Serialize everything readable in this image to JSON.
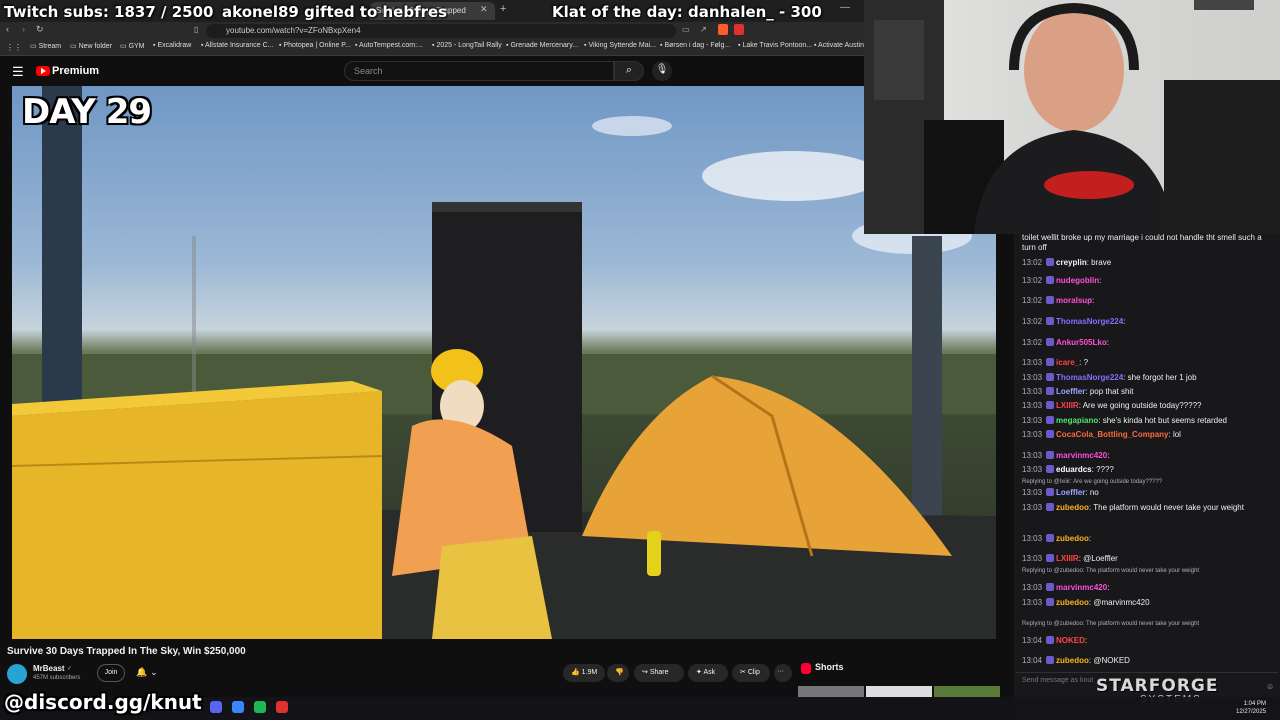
{
  "overlay": {
    "subs_text": "Twitch subs: 1837 / 2500",
    "gift_text": "akonel89 gifted to hebfres",
    "klat_text": "Klat of the day: danhalen_ - 300",
    "discord_text": "@discord.gg/knut"
  },
  "browser": {
    "active_tab": "Survive 30 Days Trapped",
    "url": "youtube.com/watch?v=ZFoNBxpXen4",
    "bookmarks": [
      "Stream",
      "New folder",
      "GYM",
      "Excalidraw",
      "Allstate Insurance C...",
      "Photopea | Online P...",
      "AutoTempest.com:...",
      "2025 - LongTail Rally",
      "Grenade Mercenary...",
      "Viking Syttende Mai...",
      "Børsen i dag - Følg...",
      "Lake Travis Pontoon...",
      "Activate Austin"
    ]
  },
  "youtube": {
    "brand": "Premium",
    "search_placeholder": "Search",
    "day_label": "DAY 29",
    "video_title": "Survive 30 Days Trapped In The Sky, Win $250,000",
    "channel_name": "MrBeast",
    "channel_subs": "457M subscribers",
    "join_label": "Join",
    "like_count": "1.9M",
    "share_label": "Share",
    "ask_label": "Ask",
    "clip_label": "Clip",
    "more_label": "···",
    "shorts_label": "Shorts"
  },
  "chat": {
    "colors": {
      "bg": "#18181b",
      "accent": "#9147ff"
    },
    "lines": [
      {
        "time": "",
        "user": "",
        "color": "#efeff1",
        "msg": "toilet wellit broke up my marriage i could not handle tht smell such a turn off"
      },
      {
        "time": "13:02",
        "user": "creyplin",
        "color": "#f1f1f1",
        "msg": "brave"
      },
      {
        "time": "13:02",
        "user": "nudegoblin",
        "color": "#ff4fd8",
        "msg": ""
      },
      {
        "time": "13:02",
        "user": "moralsup",
        "color": "#ff4fd8",
        "msg": ""
      },
      {
        "time": "13:02",
        "user": "ThomasNorge224",
        "color": "#8a6cff",
        "msg": ""
      },
      {
        "time": "13:02",
        "user": "Ankur505Lko",
        "color": "#ff4fd8",
        "msg": ""
      },
      {
        "time": "13:03",
        "user": "icare_",
        "color": "#ff4444",
        "msg": "?"
      },
      {
        "time": "13:03",
        "user": "ThomasNorge224",
        "color": "#8a6cff",
        "msg": "she forgot her 1 job"
      },
      {
        "time": "13:03",
        "user": "Loeffler",
        "color": "#9aa6ff",
        "msg": "pop that shit"
      },
      {
        "time": "13:03",
        "user": "LXIIIR",
        "color": "#ff4444",
        "msg": "Are we going outside today?????"
      },
      {
        "time": "13:03",
        "user": "megapiano",
        "color": "#4ee66b",
        "msg": "she's kinda hot but seems retarded"
      },
      {
        "time": "13:03",
        "user": "CocaCola_Bottling_Company",
        "color": "#ff6a3d",
        "msg": "lol"
      },
      {
        "time": "13:03",
        "user": "marvinmc420",
        "color": "#ff4fd8",
        "msg": ""
      },
      {
        "time": "13:03",
        "user": "eduardcs",
        "color": "#ffffff",
        "msg": "????"
      },
      {
        "time": "",
        "user": "",
        "color": "#adadb8",
        "msg": "Replying to @lxiiir: Are we going outside today?????"
      },
      {
        "time": "13:03",
        "user": "Loeffler",
        "color": "#9aa6ff",
        "msg": "no"
      },
      {
        "time": "13:03",
        "user": "zubedoo",
        "color": "#ffb31a",
        "msg": "The platform would never take your weight"
      },
      {
        "time": "13:03",
        "user": "zubedoo",
        "color": "#ffb31a",
        "msg": ""
      },
      {
        "time": "13:03",
        "user": "LXIIIR",
        "color": "#ff4444",
        "msg": "@Loeffler"
      },
      {
        "time": "",
        "user": "",
        "color": "#adadb8",
        "msg": "Replying to @zubedoo: The platform would never take your weight"
      },
      {
        "time": "13:03",
        "user": "marvinmc420",
        "color": "#ff4fd8",
        "msg": ""
      },
      {
        "time": "13:03",
        "user": "zubedoo",
        "color": "#ffb31a",
        "msg": "@marvinmc420"
      },
      {
        "time": "",
        "user": "",
        "color": "#adadb8",
        "msg": "Replying to @zubedoo: The platform would never take your weight"
      },
      {
        "time": "13:04",
        "user": "NOKED",
        "color": "#ff4444",
        "msg": ""
      },
      {
        "time": "13:04",
        "user": "zubedoo",
        "color": "#ffb31a",
        "msg": "@NOKED"
      }
    ],
    "input_placeholder": "Send message as knut",
    "sponsor_logo": "STARFORGE",
    "sponsor_sub": "SYSTEMS"
  },
  "taskbar": {
    "time": "1:04 PM",
    "date": "12/27/2025"
  }
}
